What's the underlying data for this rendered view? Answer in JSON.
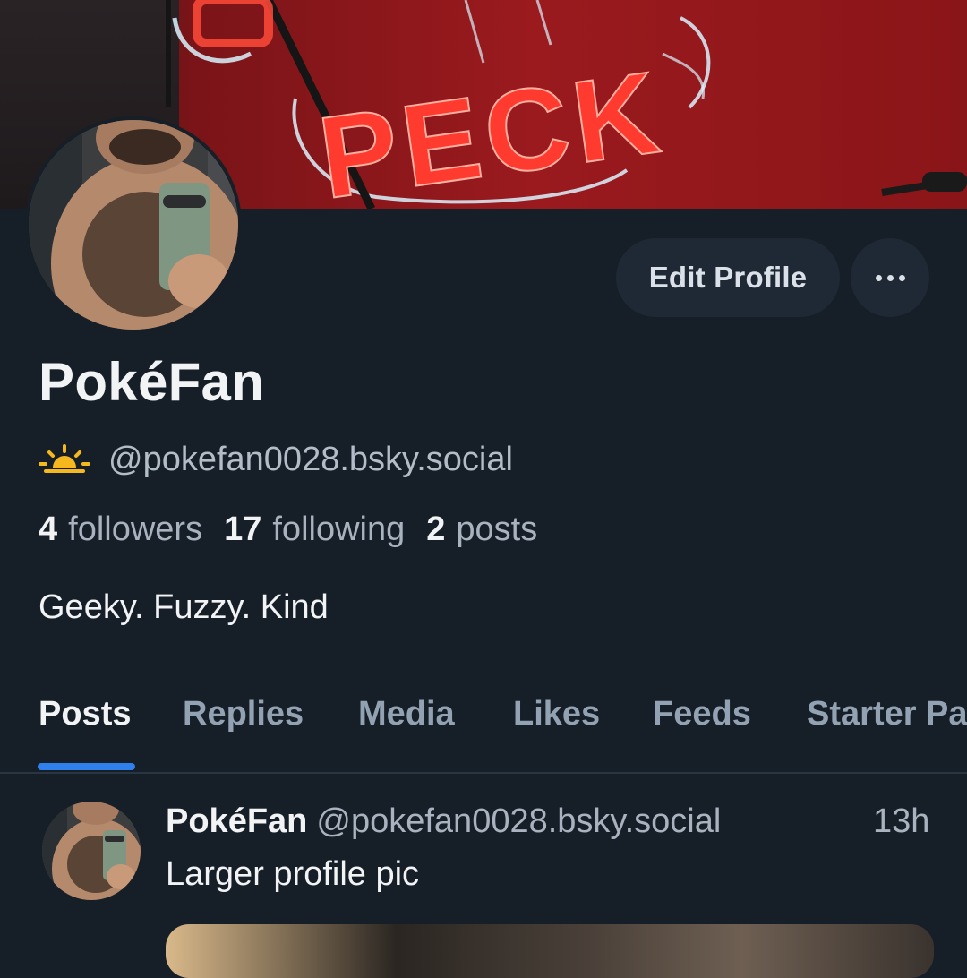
{
  "colors": {
    "background": "#161e27",
    "button_bg": "#1f2935",
    "accent": "#2f80ed",
    "muted_text": "#a8b3bf"
  },
  "banner": {
    "sign_text": "PECK"
  },
  "profile": {
    "display_name": "PokéFan",
    "status_icon": "sunrise-icon",
    "handle": "@pokefan0028.bsky.social",
    "bio": "Geeky. Fuzzy. Kind",
    "edit_label": "Edit Profile",
    "more_icon": "ellipsis-icon"
  },
  "stats": {
    "followers_count": "4",
    "followers_label": "followers",
    "following_count": "17",
    "following_label": "following",
    "posts_count": "2",
    "posts_label": "posts"
  },
  "tabs": [
    {
      "label": "Posts",
      "active": true
    },
    {
      "label": "Replies",
      "active": false
    },
    {
      "label": "Media",
      "active": false
    },
    {
      "label": "Likes",
      "active": false
    },
    {
      "label": "Feeds",
      "active": false
    },
    {
      "label": "Starter Pa",
      "active": false
    }
  ],
  "posts": [
    {
      "author": "PokéFan",
      "handle": "@pokefan0028.bsky.social",
      "time": "13h",
      "text": "Larger profile pic"
    }
  ]
}
